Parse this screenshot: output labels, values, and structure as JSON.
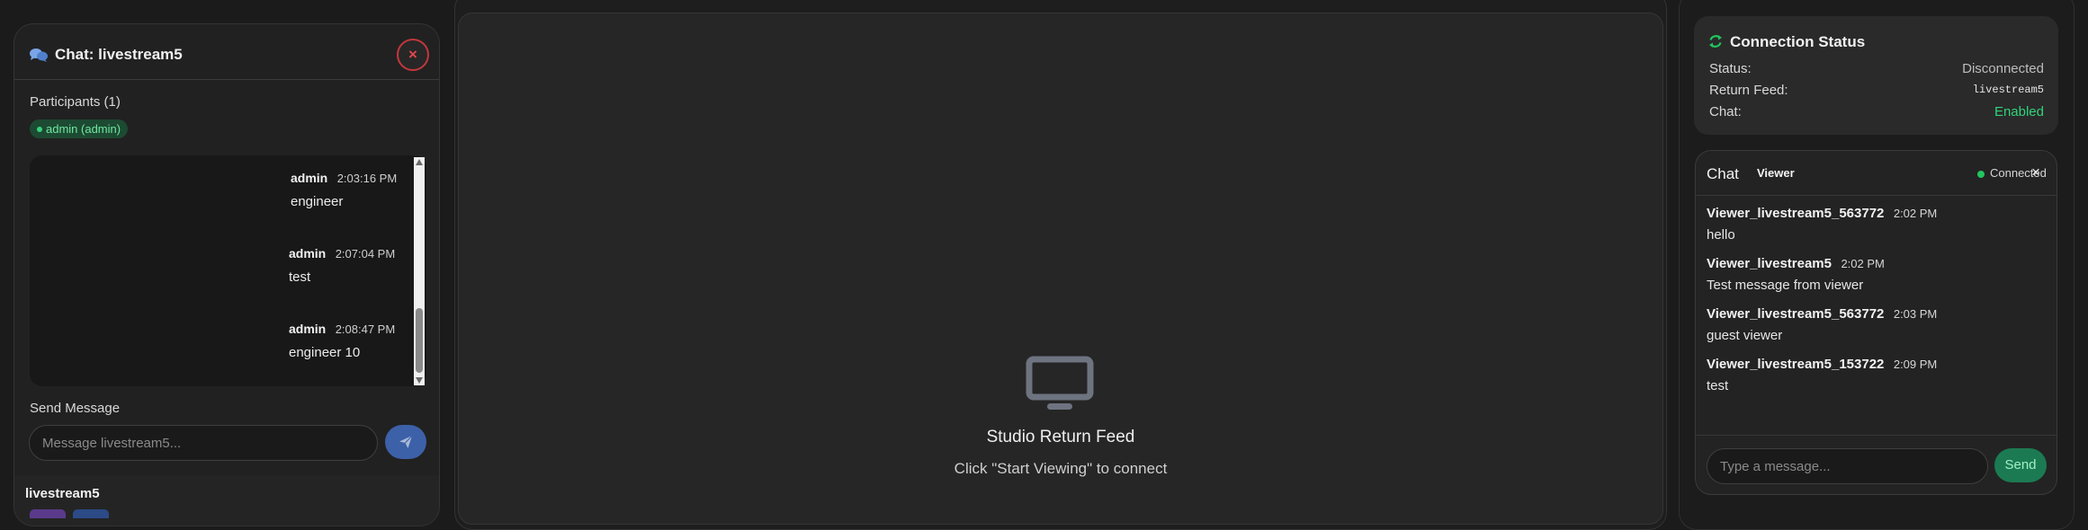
{
  "left_chat": {
    "title": "Chat: livestream5",
    "close_glyph": "×",
    "participants_label": "Participants (1)",
    "participant": "admin (admin)",
    "messages": [
      {
        "author": "admin",
        "time": "2:03:16 PM",
        "text": "engineer"
      },
      {
        "author": "admin",
        "time": "2:07:04 PM",
        "text": "test"
      },
      {
        "author": "admin",
        "time": "2:08:47 PM",
        "text": "engineer 10"
      }
    ],
    "send_label": "Send Message",
    "input_placeholder": "Message livestream5...",
    "stream_name": "livestream5",
    "icons": {
      "title": "chat-bubbles-icon",
      "send": "paper-plane-icon"
    }
  },
  "center": {
    "feed_title": "Studio Return Feed",
    "feed_subtitle": "Click \"Start Viewing\" to connect",
    "icon": "monitor-icon"
  },
  "connection_status": {
    "title": "Connection Status",
    "rows": [
      {
        "label": "Status:",
        "value": "Disconnected"
      },
      {
        "label": "Return Feed:",
        "value": "livestream5"
      },
      {
        "label": "Chat:",
        "value": "Enabled"
      }
    ],
    "icon": "refresh-icon"
  },
  "viewer_chat": {
    "title": "Chat",
    "badge": "Viewer",
    "status": "Connected",
    "close_glyph": "×",
    "messages": [
      {
        "author": "Viewer_livestream5_563772",
        "time": "2:02 PM",
        "text": "hello"
      },
      {
        "author": "Viewer_livestream5",
        "time": "2:02 PM",
        "text": "Test message from viewer"
      },
      {
        "author": "Viewer_livestream5_563772",
        "time": "2:03 PM",
        "text": "guest viewer"
      },
      {
        "author": "Viewer_livestream5_153722",
        "time": "2:09 PM",
        "text": "test"
      }
    ],
    "input_placeholder": "Type a message...",
    "send_label": "Send"
  },
  "colors": {
    "accent_green": "#22c55e",
    "close_red": "#c2373c",
    "send_blue": "#3c61a8",
    "send_green": "#1c7a52"
  }
}
